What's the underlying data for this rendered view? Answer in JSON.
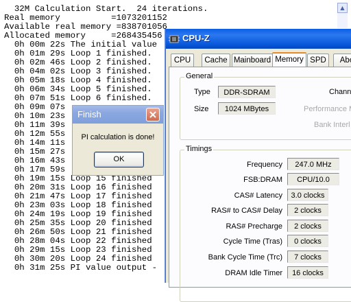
{
  "console": {
    "lines": [
      "  32M Calculation Start.  24 iterations.",
      "Real memory          =1073201152",
      "Available real memory =838701056",
      "Allocated memory     =268435456",
      "  0h 00m 22s The initial value",
      "  0h 01m 29s Loop 1 finished.",
      "  0h 02m 46s Loop 2 finished.",
      "  0h 04m 02s Loop 3 finished.",
      "  0h 05m 18s Loop 4 finished.",
      "  0h 06m 34s Loop 5 finished.",
      "  0h 07m 51s Loop 6 finished.",
      "  0h 09m 07s",
      "  0h 10m 23s",
      "  0h 11m 39s",
      "  0h 12m 55s",
      "  0h 14m 11s",
      "  0h 15m 27s",
      "  0h 16m 43s",
      "  0h 17m 59s",
      "  0h 19m 15s Loop 15 finished",
      "  0h 20m 31s Loop 16 finished",
      "  0h 21m 47s Loop 17 finished",
      "  0h 23m 03s Loop 18 finished",
      "  0h 24m 19s Loop 19 finished",
      "  0h 25m 35s Loop 20 finished",
      "  0h 26m 50s Loop 21 finished",
      "  0h 28m 04s Loop 22 finished",
      "  0h 29m 15s Loop 23 finished",
      "  0h 30m 20s Loop 24 finished",
      "  0h 31m 25s PI value output -"
    ]
  },
  "cpuz": {
    "title": "CPU-Z",
    "tabs": [
      "CPU",
      "Cache",
      "Mainboard",
      "Memory",
      "SPD",
      "Abo"
    ],
    "active_tab": "Memory",
    "general": {
      "label": "General",
      "type_label": "Type",
      "type_value": "DDR-SDRAM",
      "size_label": "Size",
      "size_value": "1024 MBytes",
      "channels_label": "Chann",
      "perf_label": "Performance M",
      "bank_label": "Bank Interl"
    },
    "timings": {
      "label": "Timings",
      "rows": [
        {
          "label": "Frequency",
          "value": "247.0 MHz"
        },
        {
          "label": "FSB:DRAM",
          "value": "CPU/10.0"
        },
        {
          "label": "CAS# Latency",
          "value": "3.0 clocks"
        },
        {
          "label": "RAS# to CAS# Delay",
          "value": "2 clocks"
        },
        {
          "label": "RAS# Precharge",
          "value": "2 clocks"
        },
        {
          "label": "Cycle Time (Tras)",
          "value": "0 clocks"
        },
        {
          "label": "Bank Cycle Time (Trc)",
          "value": "7 clocks"
        },
        {
          "label": "DRAM Idle Timer",
          "value": "16 clocks"
        }
      ]
    }
  },
  "dialog": {
    "title": "Finish",
    "message": "PI calculation is done!",
    "ok_label": "OK"
  },
  "colors": {
    "titlebar": "#0757da",
    "dialog_titlebar": "#8aa7e0",
    "active_tab_accent": "#e68b2c"
  },
  "icons": {
    "scroll_up": "scroll-up-arrow-icon",
    "cpuz_logo": "cpuz-logo-icon",
    "close": "close-icon"
  }
}
